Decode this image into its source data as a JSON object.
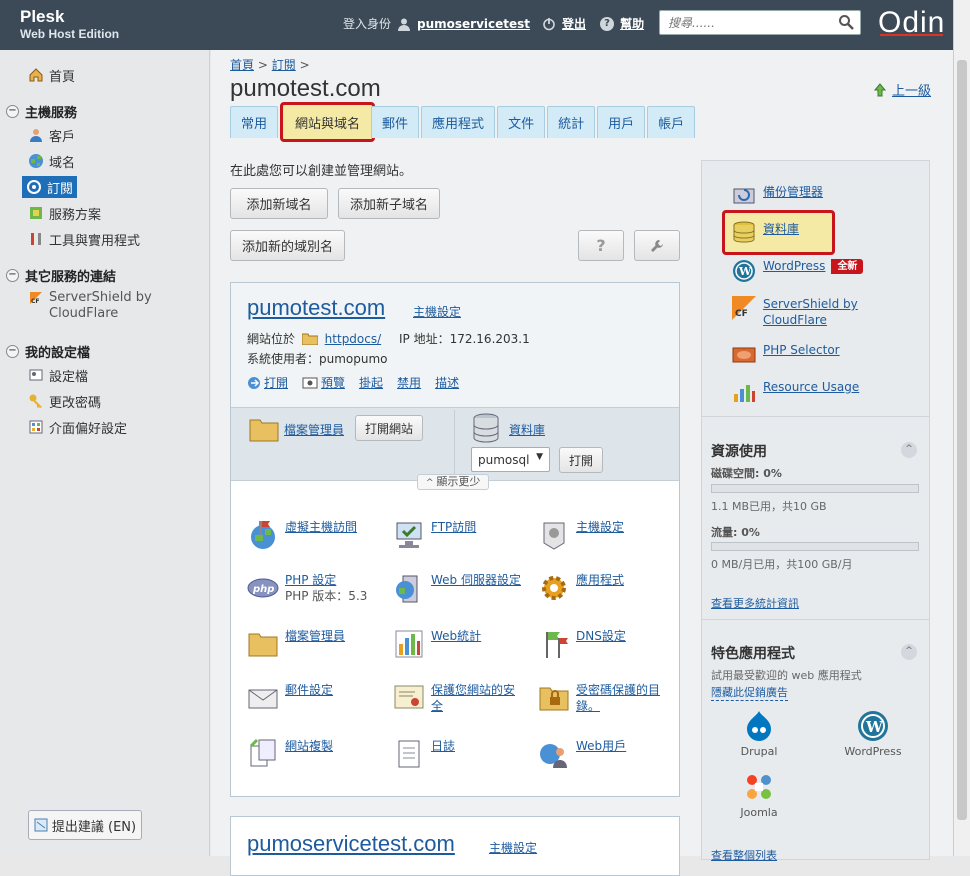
{
  "topbar": {
    "brand_line1": "Plesk",
    "brand_line2": "Web Host Edition",
    "login_as_label": "登入身份",
    "username": "pumoservicetest",
    "logout_label": "登出",
    "help_label": "幫助",
    "search_placeholder": "搜尋......",
    "vendor_logo": "Odin"
  },
  "sidebar": {
    "home": "首頁",
    "section_hosting": "主機服務",
    "customers": "客戶",
    "domains": "域名",
    "subscriptions": "訂閱",
    "service_plans": "服務方案",
    "tools": "工具與實用程式",
    "section_other": "其它服務的連結",
    "servershield": "ServerShield by CloudFlare",
    "section_profile": "我的設定檔",
    "profile": "設定檔",
    "change_password": "更改密碼",
    "interface_prefs": "介面偏好設定",
    "feedback": "提出建議 (EN)"
  },
  "main": {
    "breadcrumb_home": "首頁",
    "breadcrumb_sep": ">",
    "breadcrumb_subscriptions": "訂閱",
    "title": "pumotest.com",
    "up_level": "上一級",
    "tabs": [
      "常用",
      "網站與域名",
      "郵件",
      "應用程式",
      "文件",
      "統計",
      "用戶",
      "帳戶"
    ],
    "intro": "在此處您可以創建並管理網站。",
    "btn_add_domain": "添加新域名",
    "btn_add_subdomain": "添加新子域名",
    "btn_add_alias": "添加新的域別名",
    "btn_help": "?",
    "site": {
      "name": "pumotest.com",
      "hosting_settings": "主機設定",
      "located_at_label": "網站位於",
      "docroot": "httpdocs/",
      "ip_label": "IP 地址：172.16.203.1",
      "sys_user_label": "系統使用者：pumopumo",
      "actions": [
        "打開",
        "預覽",
        "掛起",
        "禁用",
        "描述"
      ],
      "file_manager": "檔案管理員",
      "open_site": "打開網站",
      "databases": "資料庫",
      "db_select": "pumosql",
      "db_open": "打開",
      "show_less": "顯示更少",
      "items": [
        {
          "label": "虛擬主機訪問"
        },
        {
          "label": "FTP訪問"
        },
        {
          "label": "主機設定"
        },
        {
          "label": "PHP 設定",
          "sub": "PHP 版本：5.3"
        },
        {
          "label": "Web 伺服器設定"
        },
        {
          "label": "應用程式"
        },
        {
          "label": "檔案管理員"
        },
        {
          "label": "Web統計"
        },
        {
          "label": "DNS設定"
        },
        {
          "label": "郵件設定"
        },
        {
          "label": "保護您網站的安全"
        },
        {
          "label": "受密碼保護的目錄。"
        },
        {
          "label": "網站複製"
        },
        {
          "label": "日誌"
        },
        {
          "label": "Web用戶"
        }
      ]
    },
    "site2": {
      "name": "pumoservicetest.com",
      "hosting_settings": "主機設定"
    }
  },
  "right": {
    "backup_manager": "備份管理器",
    "databases": "資料庫",
    "wordpress": "WordPress",
    "new_badge": "全新",
    "servershield": "ServerShield by CloudFlare",
    "php_selector": "PHP Selector",
    "resource_usage": "Resource Usage",
    "res_title": "資源使用",
    "disk_label": "磁碟空間: 0%",
    "disk_detail": "1.1 MB已用，共10 GB",
    "disk_pct": 0,
    "traffic_label": "流量: 0%",
    "traffic_detail": "0 MB/月已用，共100 GB/月",
    "traffic_pct": 0,
    "more_stats": "查看更多統計資訊",
    "featured_title": "特色應用程式",
    "featured_desc": "試用最受歡迎的 web 應用程式",
    "hide_ad": "隱藏此促銷廣告",
    "apps": [
      "Drupal",
      "WordPress",
      "Joomla"
    ],
    "view_all": "查看整個列表"
  },
  "colors": {
    "topbar": "#3c4a57",
    "link": "#1d5b9e",
    "highlight_border": "#c8151b",
    "highlight_fill": "#f4e9a5",
    "tab_bg": "#d3ebf6",
    "active_sidebar": "#1e6fb8"
  }
}
